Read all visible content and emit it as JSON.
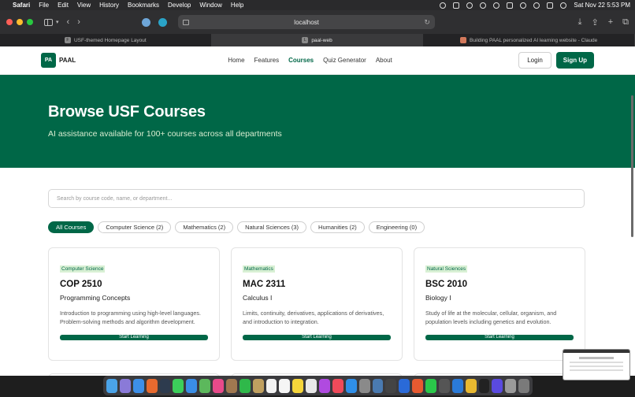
{
  "menubar": {
    "app": "Safari",
    "items": [
      "File",
      "Edit",
      "View",
      "History",
      "Bookmarks",
      "Develop",
      "Window",
      "Help"
    ],
    "datetime": "Sat Nov 22  5:53 PM"
  },
  "browser": {
    "url": "localhost",
    "tabs": [
      {
        "label": "USF-themed Homepage Layout",
        "favicon": "F"
      },
      {
        "label": "paal-web",
        "favicon": "L"
      },
      {
        "label": "Building PAAL personalized AI learning website - Claude",
        "favicon": ""
      }
    ]
  },
  "site": {
    "logo_badge": "PA",
    "logo_text": "PAAL",
    "nav": [
      "Home",
      "Features",
      "Courses",
      "Quiz Generator",
      "About"
    ],
    "login": "Login",
    "signup": "Sign Up"
  },
  "hero": {
    "title": "Browse USF Courses",
    "subtitle": "AI assistance available for 100+ courses across all departments"
  },
  "search": {
    "placeholder": "Search by course code, name, or department..."
  },
  "filters": [
    "All Courses",
    "Computer Science (2)",
    "Mathematics (2)",
    "Natural Sciences (3)",
    "Humanities (2)",
    "Engineering (0)"
  ],
  "courses": [
    {
      "category": "Computer Science",
      "code": "COP 2510",
      "name": "Programming Concepts",
      "description": "Introduction to programming using high-level languages. Problem-solving methods and algorithm development.",
      "cta": "Start Learning"
    },
    {
      "category": "Mathematics",
      "code": "MAC 2311",
      "name": "Calculus I",
      "description": "Limits, continuity, derivatives, applications of derivatives, and introduction to integration.",
      "cta": "Start Learning"
    },
    {
      "category": "Natural Sciences",
      "code": "BSC 2010",
      "name": "Biology I",
      "description": "Study of life at the molecular, cellular, organism, and population levels including genetics and evolution.",
      "cta": "Start Learning"
    }
  ],
  "colors": {
    "primary": "#006747",
    "category_bg": "#d8f0d4"
  }
}
